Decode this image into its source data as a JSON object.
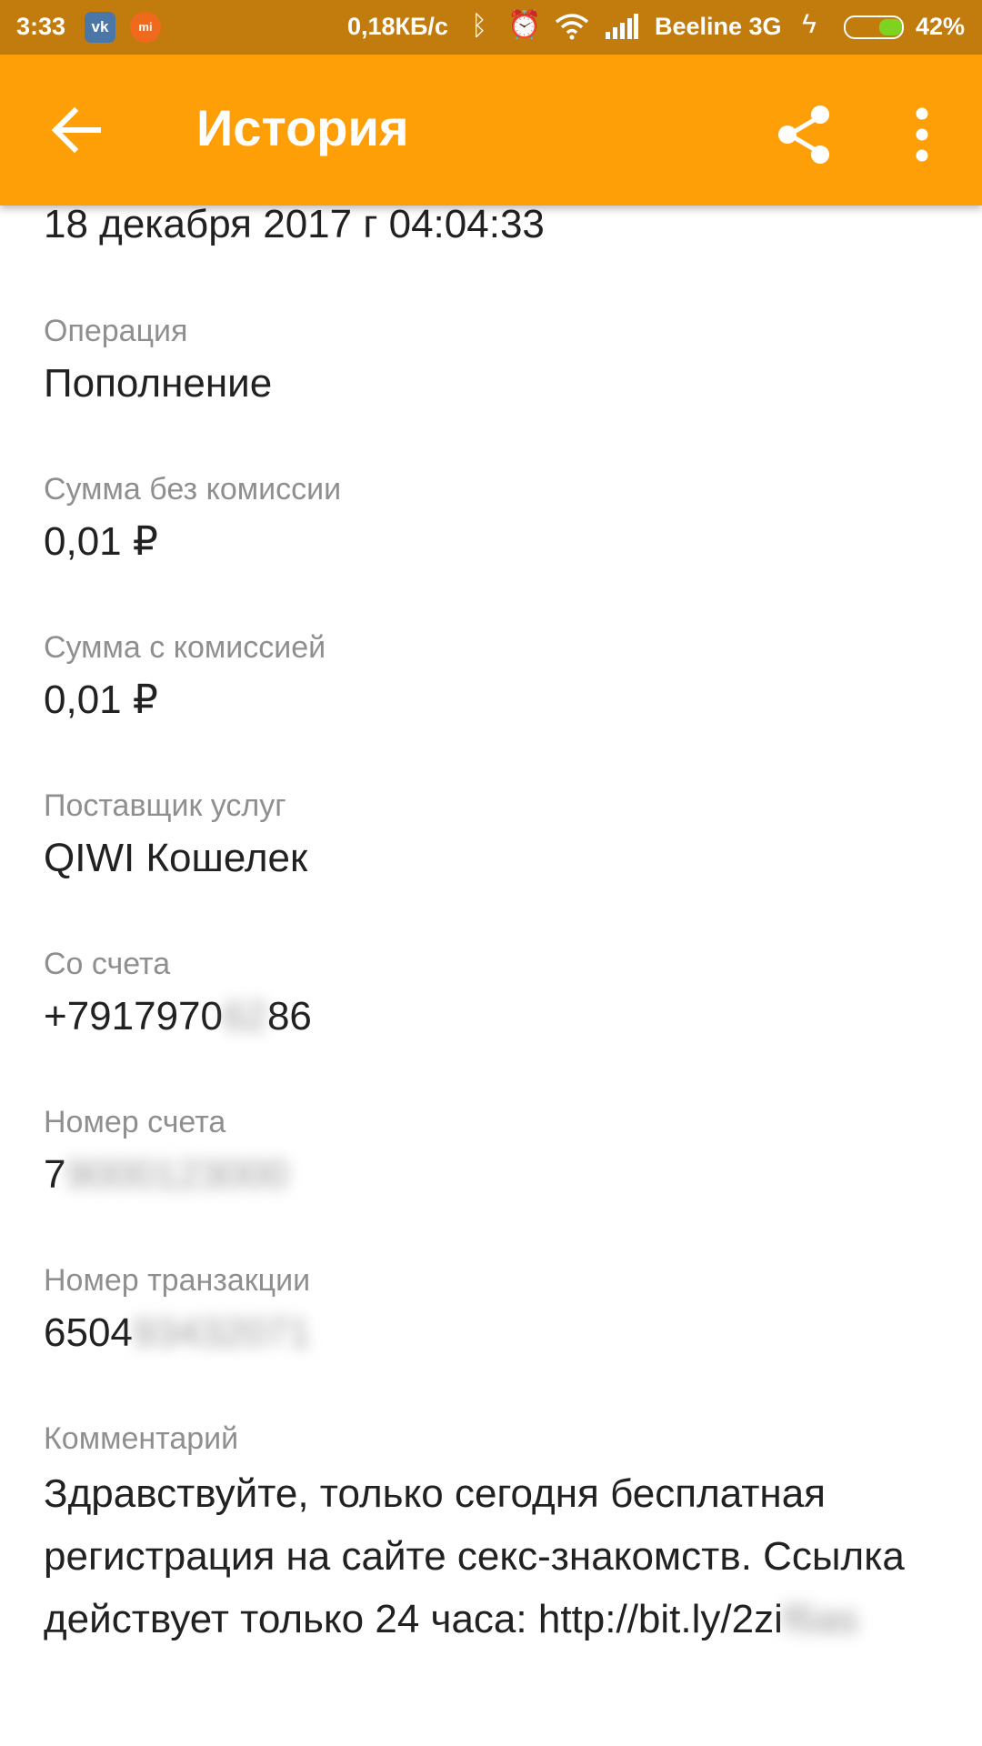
{
  "status_bar": {
    "time": "3:33",
    "vk_icon": "vk-icon",
    "mi_icon": "mi-icon",
    "speed": "0,18КБ/с",
    "carrier": "Beeline 3G",
    "battery_percent": "42%",
    "battery_level": 0.42
  },
  "app_bar": {
    "title": "История",
    "color": "#ff9f07"
  },
  "details": {
    "date": "18 декабря 2017 г 04:04:33",
    "operation_label": "Операция",
    "operation_value": "Пополнение",
    "amount_no_fee_label": "Сумма без комиссии",
    "amount_no_fee_value": "0,01 ₽",
    "amount_with_fee_label": "Сумма с комиссией",
    "amount_with_fee_value": "0,01 ₽",
    "provider_label": "Поставщик услуг",
    "provider_value": "QIWI Кошелек",
    "from_account_label": "Со счета",
    "from_account_visible_start": "+7917970",
    "from_account_hidden": "62",
    "from_account_visible_end": "86",
    "account_number_label": "Номер счета",
    "account_number_visible": "7",
    "account_number_hidden": "9000123000",
    "transaction_label": "Номер транзакции",
    "transaction_visible": "6504",
    "transaction_hidden": "93432071",
    "comment_label": "Комментарий",
    "comment_text": "Здравствуйте, только сегодня бесплатная регистрация на сайте секс-знакомств. Ссылка действует только 24 часа: http://bit.ly/2zi",
    "comment_hidden": "f6as"
  }
}
